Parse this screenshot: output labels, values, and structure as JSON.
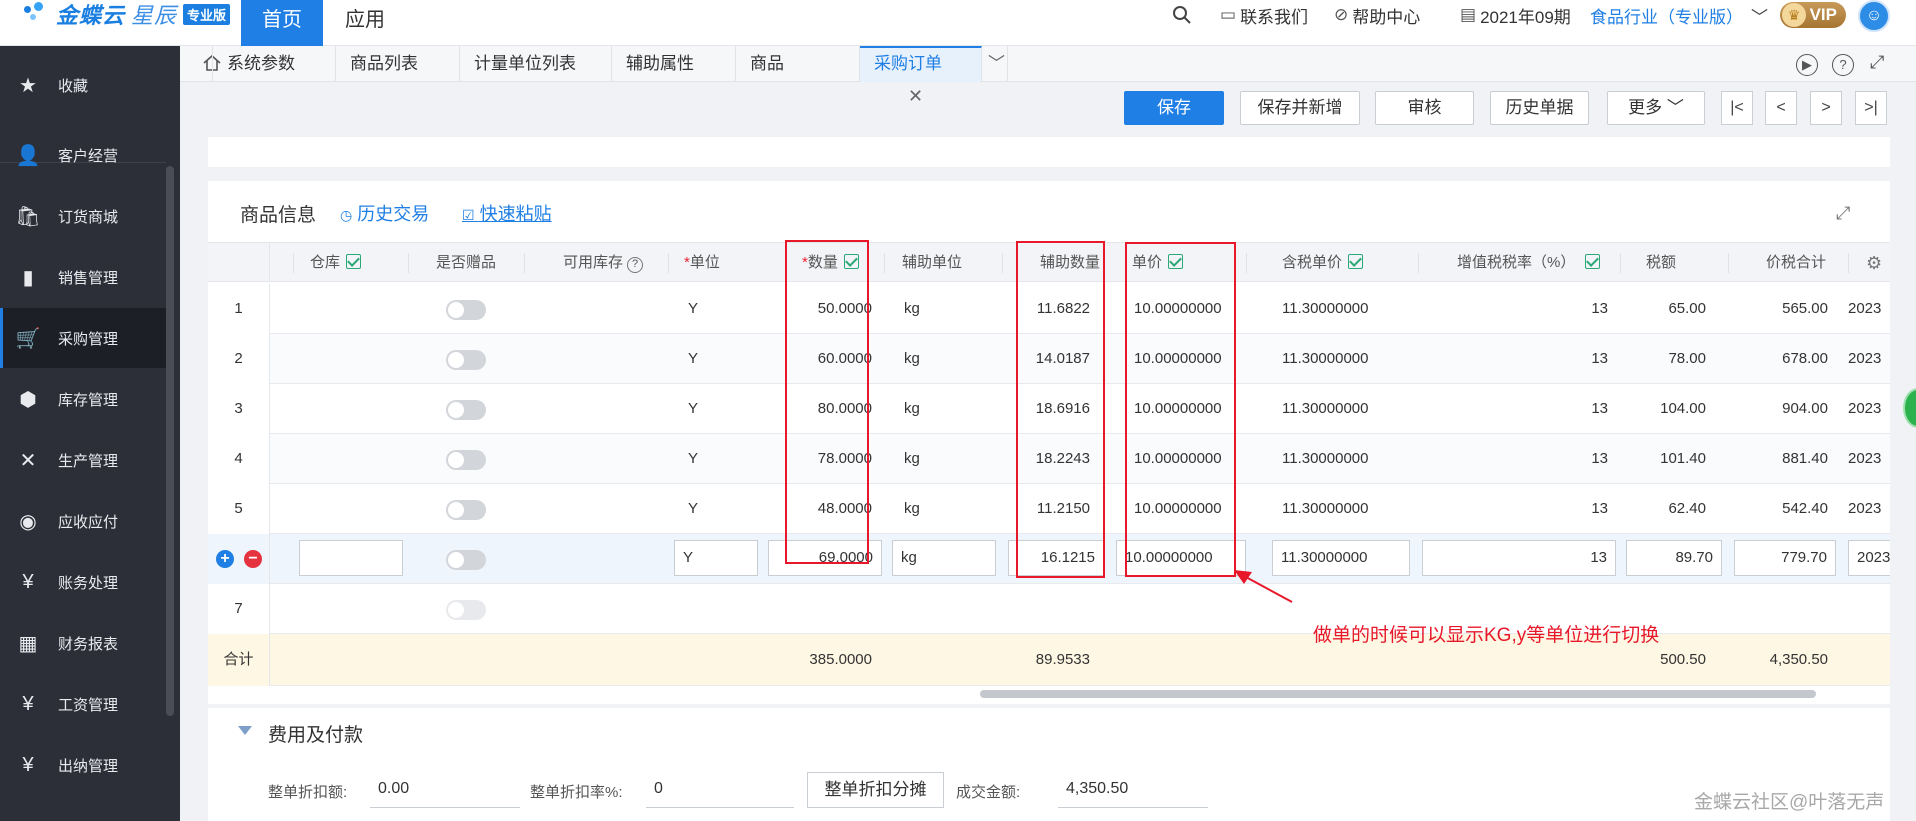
{
  "topbar": {
    "brand": "金蝶云",
    "brand_italic": "星辰",
    "brand_badge": "专业版",
    "nav_home": "首页",
    "nav_apps": "应用",
    "contact": "联系我们",
    "help": "帮助中心",
    "period": "2021年09期",
    "industry": "食品行业（专业版）",
    "vip": "VIP"
  },
  "sidebar": {
    "items": [
      {
        "label": "收藏",
        "icon": "star-icon"
      },
      {
        "label": "客户经营",
        "icon": "customer-icon"
      },
      {
        "label": "订货商城",
        "icon": "shopping-bag-icon"
      },
      {
        "label": "销售管理",
        "icon": "bar-chart-icon"
      },
      {
        "label": "采购管理",
        "icon": "cart-icon"
      },
      {
        "label": "库存管理",
        "icon": "box-icon"
      },
      {
        "label": "生产管理",
        "icon": "tools-icon"
      },
      {
        "label": "应收应付",
        "icon": "receivable-icon"
      },
      {
        "label": "账务处理",
        "icon": "accounting-icon"
      },
      {
        "label": "财务报表",
        "icon": "report-icon"
      },
      {
        "label": "工资管理",
        "icon": "salary-icon"
      },
      {
        "label": "出纳管理",
        "icon": "cashier-icon"
      }
    ]
  },
  "tabs": [
    "系统参数",
    "商品列表",
    "计量单位列表",
    "辅助属性",
    "商品",
    "采购订单"
  ],
  "toolbar": {
    "save": "保存",
    "save_new": "保存并新增",
    "audit": "审核",
    "history": "历史单据",
    "more": "更多"
  },
  "section": {
    "title": "商品信息",
    "history_trade": "历史交易",
    "quick_paste": "快速粘贴"
  },
  "grid": {
    "headers": {
      "warehouse": "仓库",
      "gift": "是否赠品",
      "stock": "可用库存",
      "unit": "单位",
      "qty": "数量",
      "aux_unit": "辅助单位",
      "aux_qty": "辅助数量",
      "price": "单价",
      "tax_price": "含税单价",
      "tax_rate": "增值税税率（%）",
      "tax": "税额",
      "total": "价税合计"
    },
    "rows": [
      {
        "no": "1",
        "unit": "Y",
        "qty": "50.0000",
        "aux_unit": "kg",
        "aux_qty": "11.6822",
        "price": "10.00000000",
        "tax_price": "11.30000000",
        "tax_rate": "13",
        "tax": "65.00",
        "total": "565.00",
        "date": "2023"
      },
      {
        "no": "2",
        "unit": "Y",
        "qty": "60.0000",
        "aux_unit": "kg",
        "aux_qty": "14.0187",
        "price": "10.00000000",
        "tax_price": "11.30000000",
        "tax_rate": "13",
        "tax": "78.00",
        "total": "678.00",
        "date": "2023"
      },
      {
        "no": "3",
        "unit": "Y",
        "qty": "80.0000",
        "aux_unit": "kg",
        "aux_qty": "18.6916",
        "price": "10.00000000",
        "tax_price": "11.30000000",
        "tax_rate": "13",
        "tax": "104.00",
        "total": "904.00",
        "date": "2023"
      },
      {
        "no": "4",
        "unit": "Y",
        "qty": "78.0000",
        "aux_unit": "kg",
        "aux_qty": "18.2243",
        "price": "10.00000000",
        "tax_price": "11.30000000",
        "tax_rate": "13",
        "tax": "101.40",
        "total": "881.40",
        "date": "2023"
      },
      {
        "no": "5",
        "unit": "Y",
        "qty": "48.0000",
        "aux_unit": "kg",
        "aux_qty": "11.2150",
        "price": "10.00000000",
        "tax_price": "11.30000000",
        "tax_rate": "13",
        "tax": "62.40",
        "total": "542.40",
        "date": "2023"
      }
    ],
    "edit_row": {
      "unit": "Y",
      "qty": "69.0000",
      "aux_unit": "kg",
      "aux_qty": "16.1215",
      "price": "10.00000000",
      "tax_price": "11.30000000",
      "tax_rate": "13",
      "tax": "89.70",
      "total": "779.70",
      "date": "2023"
    },
    "row7_no": "7",
    "total_row": {
      "label": "合计",
      "qty": "385.0000",
      "aux_qty": "89.9533",
      "tax": "500.50",
      "total": "4,350.50"
    }
  },
  "annotation": "做单的时候可以显示KG,y等单位进行切换",
  "fees": {
    "title": "费用及付款",
    "discount_amount_label": "整单折扣额:",
    "discount_amount": "0.00",
    "discount_rate_label": "整单折扣率%:",
    "discount_rate": "0",
    "allocate_button": "整单折扣分摊",
    "deal_amount_label": "成交金额:",
    "deal_amount": "4,350.50"
  },
  "watermark": "金蝶云社区@叶落无声"
}
